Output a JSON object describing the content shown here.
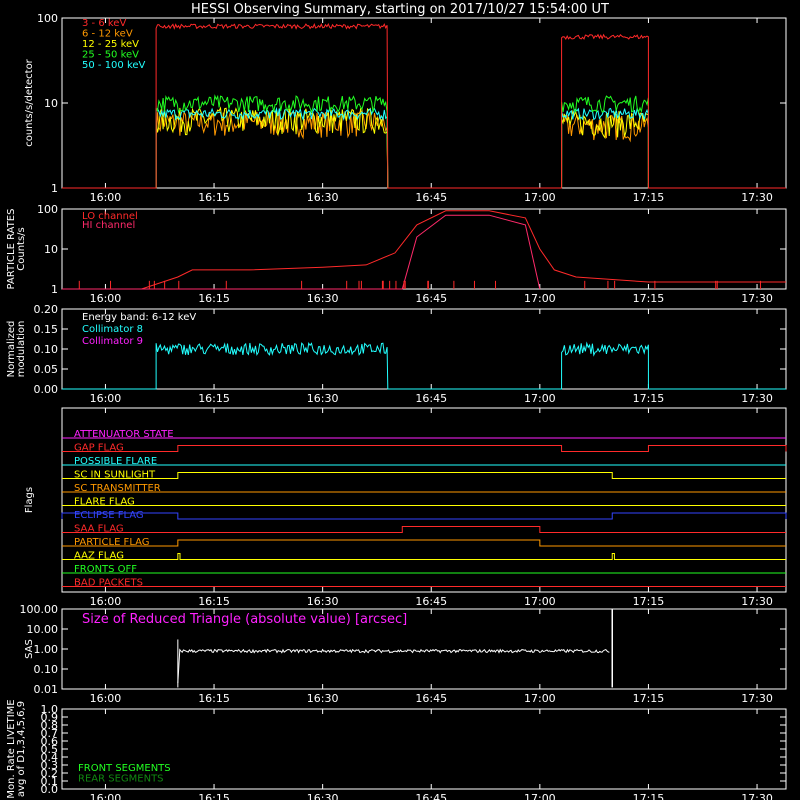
{
  "title": "HESSI Observing Summary, starting on 2017/10/27 15:54:00 UT",
  "time_ticks": [
    "16:00",
    "16:15",
    "16:30",
    "16:45",
    "17:00",
    "17:15",
    "17:30"
  ],
  "colors": {
    "background": "#000000",
    "axes": "#ffffff",
    "red": "#ff2a2a",
    "orange": "#ff9900",
    "yellow": "#ffff00",
    "green": "#22ff22",
    "cyan": "#22ffff",
    "magenta": "#ff22ff",
    "darkgreen": "#118811",
    "blue": "#3344ff"
  },
  "chart_data": [
    {
      "id": "rates",
      "type": "line",
      "ylabel": "counts/s/detector",
      "yscale": "log",
      "ylim": [
        1,
        100
      ],
      "yticks": [
        "1",
        "10",
        "100"
      ],
      "legend_placement": "top-left",
      "segments": [
        [
          "16:07",
          "16:39"
        ],
        [
          "17:03",
          "17:15"
        ]
      ],
      "series": [
        {
          "name": "3 - 6 keV",
          "color": "#ff2a2a",
          "level": 80,
          "level2": 60,
          "noise": 0.06
        },
        {
          "name": "6 - 12 keV",
          "color": "#ff9900",
          "level": 6.0,
          "level2": 5.5,
          "noise": 0.35
        },
        {
          "name": "12 - 25 keV",
          "color": "#ffff00",
          "level": 6.5,
          "level2": 6.0,
          "noise": 0.35
        },
        {
          "name": "25 - 50 keV",
          "color": "#22ff22",
          "level": 10,
          "level2": 10,
          "noise": 0.22
        },
        {
          "name": "50 - 100 keV",
          "color": "#22ffff",
          "level": 7.5,
          "level2": 7.5,
          "noise": 0.15
        }
      ]
    },
    {
      "id": "particle",
      "type": "line",
      "ylabel": "PARTICLE RATES\nCounts/s",
      "yscale": "log",
      "ylim": [
        1,
        100
      ],
      "yticks": [
        "1",
        "10",
        "100"
      ],
      "series": [
        {
          "name": "LO channel",
          "color": "#ff2a2a",
          "points": [
            [
              "16:05",
              "1"
            ],
            [
              "16:10",
              "2"
            ],
            [
              "16:12",
              "3"
            ],
            [
              "16:20",
              "3"
            ],
            [
              "16:30",
              "3.5"
            ],
            [
              "16:36",
              "4"
            ],
            [
              "16:40",
              "8"
            ],
            [
              "16:43",
              "40"
            ],
            [
              "16:47",
              "90"
            ],
            [
              "16:53",
              "90"
            ],
            [
              "16:58",
              "60"
            ],
            [
              "17:00",
              "10"
            ],
            [
              "17:02",
              "3"
            ],
            [
              "17:05",
              "2"
            ],
            [
              "17:15",
              "1.5"
            ]
          ]
        },
        {
          "name": "HI channel",
          "color": "#ff2a6a",
          "points": [
            [
              "16:41",
              "1"
            ],
            [
              "16:43",
              "20"
            ],
            [
              "16:47",
              "70"
            ],
            [
              "16:53",
              "70"
            ],
            [
              "16:58",
              "40"
            ],
            [
              "17:00",
              "1"
            ]
          ]
        }
      ]
    },
    {
      "id": "modulation",
      "type": "line",
      "ylabel": "Normalized\nmodulation",
      "ylim": [
        0,
        0.2
      ],
      "yticks": [
        "0.00",
        "0.05",
        "0.10",
        "0.15",
        "0.20"
      ],
      "note": "Energy band: 6-12 keV",
      "segments": [
        [
          "16:07",
          "16:39"
        ],
        [
          "17:03",
          "17:15"
        ]
      ],
      "series": [
        {
          "name": "Collimator 8",
          "color": "#22ffff",
          "level": 0.1,
          "noise": 0.015
        },
        {
          "name": "Collimator 9",
          "color": "#ff22ff",
          "level": 0,
          "noise": 0
        }
      ]
    },
    {
      "id": "flags",
      "type": "line",
      "ylabel": "Flags",
      "flags": [
        {
          "name": "ATTENUATOR STATE",
          "color": "#ff22ff",
          "on": []
        },
        {
          "name": "GAP FLAG",
          "color": "#ff2a2a",
          "on": [
            [
              "16:10",
              "17:03"
            ],
            [
              "17:15",
              "17:34"
            ]
          ]
        },
        {
          "name": "POSSIBLE FLARE",
          "color": "#22ffff",
          "on": []
        },
        {
          "name": "SC IN SUNLIGHT",
          "color": "#ffff00",
          "on": [
            [
              "16:10",
              "17:10"
            ]
          ]
        },
        {
          "name": "SC TRANSMITTER",
          "color": "#ff9900",
          "on": []
        },
        {
          "name": "FLARE FLAG",
          "color": "#ffff00",
          "on": []
        },
        {
          "name": "ECLIPSE FLAG",
          "color": "#3344ff",
          "on": [
            [
              "15:54",
              "16:10"
            ],
            [
              "17:10",
              "17:34"
            ]
          ]
        },
        {
          "name": "SAA FLAG",
          "color": "#ff2a2a",
          "on": [
            [
              "16:41",
              "17:00"
            ]
          ]
        },
        {
          "name": "PARTICLE FLAG",
          "color": "#ff9900",
          "on": [
            [
              "16:10",
              "17:00"
            ]
          ]
        },
        {
          "name": "AAZ FLAG",
          "color": "#ffff00",
          "on": [
            [
              "16:10",
              "16:10.3"
            ],
            [
              "17:10",
              "17:10.3"
            ]
          ]
        },
        {
          "name": "FRONTS OFF",
          "color": "#22ff22",
          "on": []
        },
        {
          "name": "BAD PACKETS",
          "color": "#ff2a2a",
          "on": []
        }
      ]
    },
    {
      "id": "sas",
      "type": "line",
      "ylabel": "SAS",
      "yscale": "log",
      "ylim": [
        0.01,
        100
      ],
      "yticks": [
        "0.01",
        "0.10",
        "1.00",
        "10.00",
        "100.00"
      ],
      "series": [
        {
          "name": "Size of Reduced Triangle (absolute value) [arcsec]",
          "color": "#ff22ff",
          "trace_color": "#ffffff",
          "segment": [
            "16:10",
            "17:10"
          ],
          "level": 0.8
        }
      ]
    },
    {
      "id": "livetime",
      "type": "line",
      "ylabel": "Mon. Rate LIVETIME\navg of D1,3,4,5,6,9",
      "ylim": [
        0,
        1
      ],
      "yticks": [
        "0.0",
        "0.1",
        "0.2",
        "0.3",
        "0.4",
        "0.5",
        "0.6",
        "0.7",
        "0.8",
        "0.9",
        "1.0"
      ],
      "series": [
        {
          "name": "FRONT SEGMENTS",
          "color": "#22ff22"
        },
        {
          "name": "REAR SEGMENTS",
          "color": "#118811"
        }
      ]
    }
  ]
}
